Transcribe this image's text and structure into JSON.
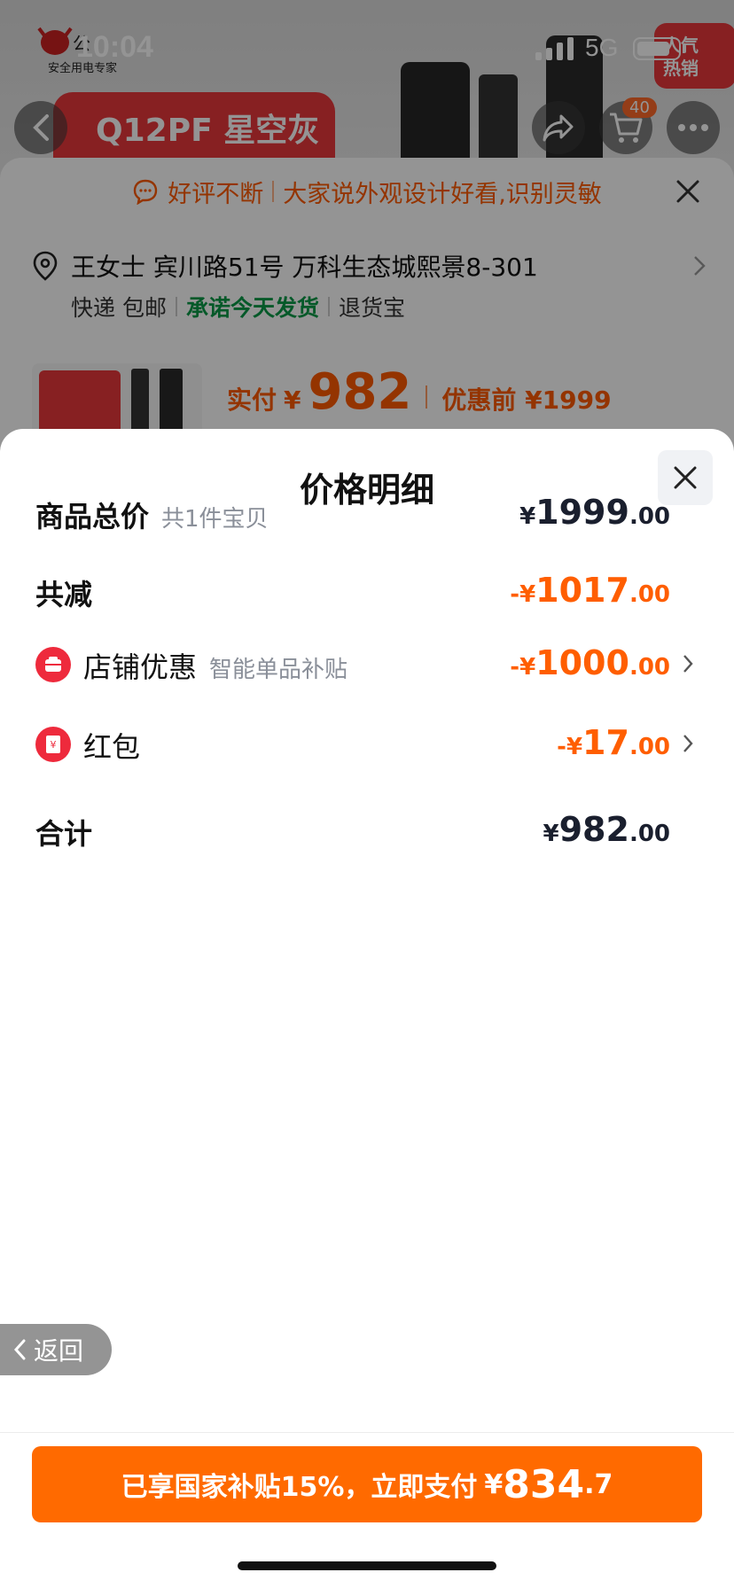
{
  "status_bar": {
    "time": "10:04",
    "network": "5G"
  },
  "background": {
    "hero_banner": "Q12PF 星空灰",
    "hero_logo_text": "安全用电专家",
    "hero_tag": "人气\n热销",
    "cart_count": "40",
    "review_text": "好评不断",
    "review_detail": "大家说外观设计好看,识别灵敏",
    "address": "王女士 宾川路51号 万科生态城熙景8-301",
    "shipping": {
      "express": "快递 包邮",
      "promise": "承诺今天发货",
      "return": "退货宝"
    },
    "price": {
      "label": "实付",
      "yen": "¥",
      "value": "982",
      "before_label": "优惠前 ¥1999"
    }
  },
  "sheet": {
    "title": "价格明细",
    "rows": {
      "total": {
        "label": "商品总价",
        "sub": "共1件宝贝",
        "yen": "¥",
        "int": "1999",
        "dec": ".00"
      },
      "discount": {
        "label": "共减",
        "yen": "-¥",
        "int": "1017",
        "dec": ".00"
      },
      "shop": {
        "label": "店铺优惠",
        "sub": "智能单品补贴",
        "yen": "-¥",
        "int": "1000",
        "dec": ".00"
      },
      "redpacket": {
        "label": "红包",
        "yen": "-¥",
        "int": "17",
        "dec": ".00"
      },
      "sum": {
        "label": "合计",
        "yen": "¥",
        "int": "982",
        "dec": ".00"
      }
    }
  },
  "back_label": "返回",
  "pay_button": {
    "text": "已享国家补贴15%，立即支付",
    "yen": "¥",
    "int": "834",
    "dec": ".7"
  },
  "colors": {
    "accent": "#ff6a00",
    "discount": "#ff5e00",
    "green": "#0a9a47",
    "icon_red": "#ee2a3c"
  },
  "icons": [
    "signal-icon",
    "battery-icon",
    "back-arrow-icon",
    "share-icon",
    "cart-icon",
    "more-icon",
    "chat-icon",
    "close-icon",
    "location-icon",
    "chevron-right-icon",
    "shop-icon",
    "red-packet-icon",
    "chevron-left-icon"
  ]
}
